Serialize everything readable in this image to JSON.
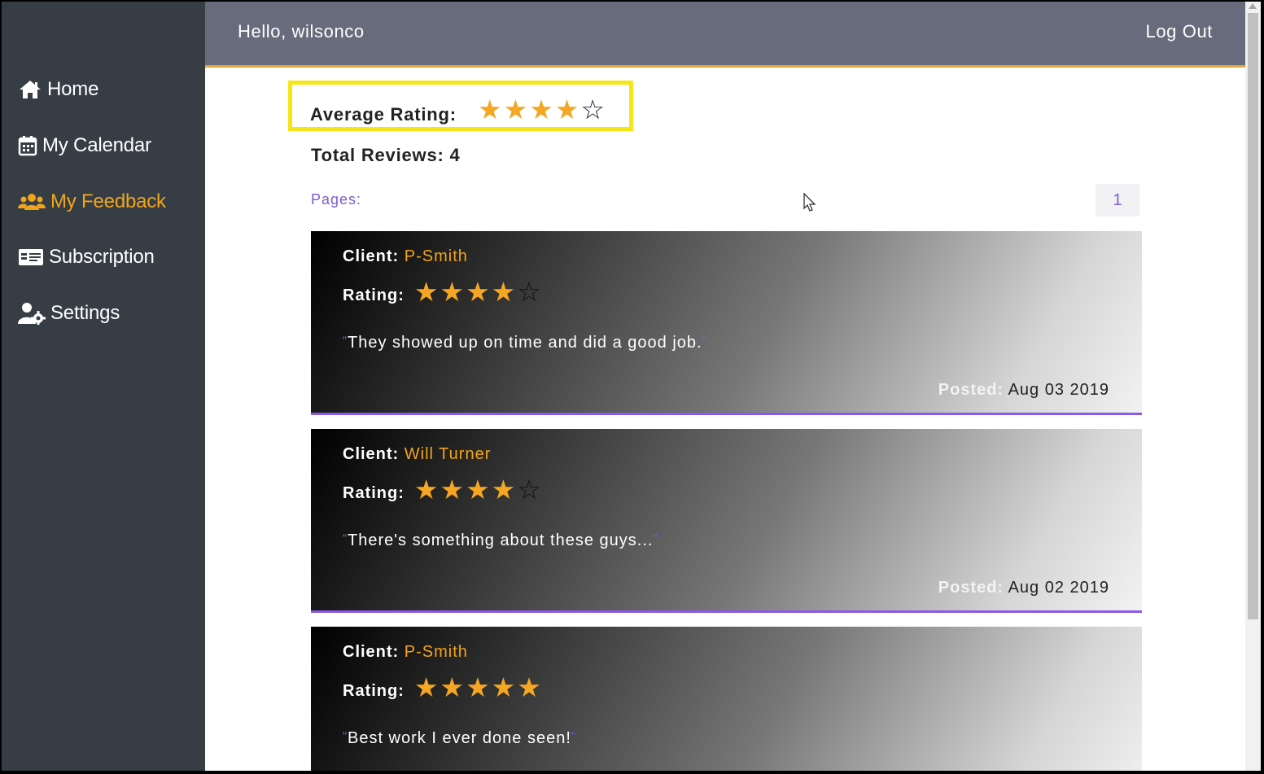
{
  "header": {
    "greeting": "Hello, wilsonco",
    "logout_label": "Log Out"
  },
  "sidebar": {
    "items": [
      {
        "label": "Home",
        "icon": "home-icon"
      },
      {
        "label": "My Calendar",
        "icon": "calendar-icon"
      },
      {
        "label": "My Feedback",
        "icon": "users-icon",
        "active": true
      },
      {
        "label": "Subscription",
        "icon": "id-card-icon"
      },
      {
        "label": "Settings",
        "icon": "user-cog-icon"
      }
    ]
  },
  "summary": {
    "average_label": "Average Rating:",
    "average_rating": 4,
    "max_rating": 5,
    "total_reviews_label": "Total Reviews: 4"
  },
  "pagination": {
    "label": "Pages:",
    "pages": [
      "1"
    ]
  },
  "review_labels": {
    "client": "Client:",
    "rating": "Rating:",
    "posted": "Posted:"
  },
  "reviews": [
    {
      "client": "P-Smith",
      "rating": 4,
      "text": "They showed up on time and did a good job.",
      "posted": "Aug 03 2019"
    },
    {
      "client": "Will Turner",
      "rating": 4,
      "text": "There's something about these guys...",
      "posted": "Aug 02 2019"
    },
    {
      "client": "P-Smith",
      "rating": 5,
      "text": "Best work I ever done seen!",
      "posted": ""
    }
  ],
  "colors": {
    "sidebar_bg": "#363d45",
    "header_bg": "#676b7c",
    "accent_orange": "#f2a51a",
    "accent_purple": "#8a5be6",
    "highlight_yellow": "#f5e617"
  }
}
